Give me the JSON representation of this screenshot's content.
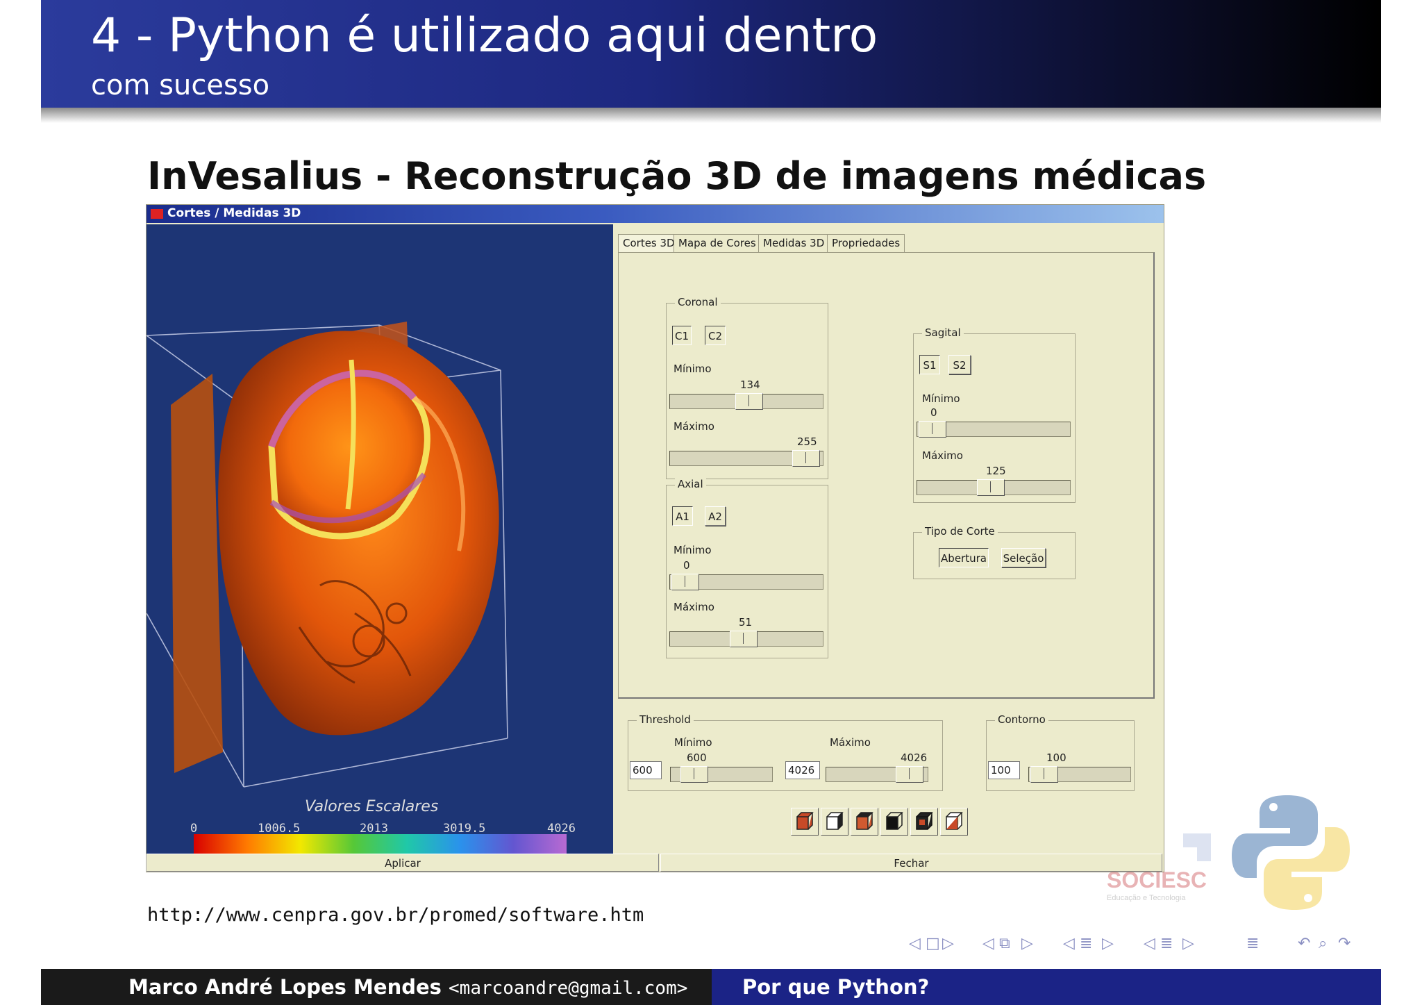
{
  "header": {
    "title": "4 - Python é utilizado aqui dentro",
    "subtitle": "com sucesso"
  },
  "frame_title": "InVesalius - Reconstrução 3D de imagens médicas",
  "app": {
    "window_title": "Cortes / Medidas 3D",
    "tabs": [
      "Cortes 3D",
      "Mapa de Cores",
      "Medidas 3D",
      "Propriedades"
    ],
    "coronal": {
      "label": "Coronal",
      "buttons": [
        "C1",
        "C2"
      ],
      "min_label": "Mínimo",
      "min_value": "134",
      "max_label": "Máximo",
      "max_value": "255"
    },
    "axial": {
      "label": "Axial",
      "buttons": [
        "A1",
        "A2"
      ],
      "min_label": "Mínimo",
      "min_value": "0",
      "max_label": "Máximo",
      "max_value": "51"
    },
    "sagital": {
      "label": "Sagital",
      "buttons": [
        "S1",
        "S2"
      ],
      "min_label": "Mínimo",
      "min_value": "0",
      "max_label": "Máximo",
      "max_value": "125"
    },
    "tipo_corte": {
      "label": "Tipo de Corte",
      "buttons": [
        "Abertura",
        "Seleção"
      ]
    },
    "threshold": {
      "label": "Threshold",
      "min_label": "Mínimo",
      "min_value": "600",
      "min_field": "600",
      "max_label": "Máximo",
      "max_value": "4026",
      "max_field": "4026"
    },
    "contorno": {
      "label": "Contorno",
      "value": "100",
      "field": "100"
    },
    "colorbar": {
      "title": "Valores Escalares",
      "ticks": [
        "0",
        "1006.5",
        "2013",
        "3019.5",
        "4026"
      ]
    },
    "apply_label": "Aplicar",
    "close_label": "Fechar",
    "view_icons": [
      "cube-front-icon",
      "cube-side-icon",
      "cube-top-icon",
      "cube-solid-icon",
      "cube-dark-icon",
      "cube-cut-icon"
    ]
  },
  "url": "http://www.cenpra.gov.br/promed/software.htm",
  "logos": {
    "sociesc_text": "SOCIESC",
    "sociesc_tagline": "Educação e Tecnologia"
  },
  "footer": {
    "author": "Marco André Lopes Mendes",
    "email": "<marcoandre@gmail.com>",
    "title": "Por que Python?"
  },
  "colors": {
    "header_start": "#2b3b9c",
    "header_end": "#000000",
    "footer_left": "#1a1a1a",
    "footer_right": "#1b2386",
    "app_bg": "#ecebcc",
    "viewport_bg": "#1d3575"
  }
}
